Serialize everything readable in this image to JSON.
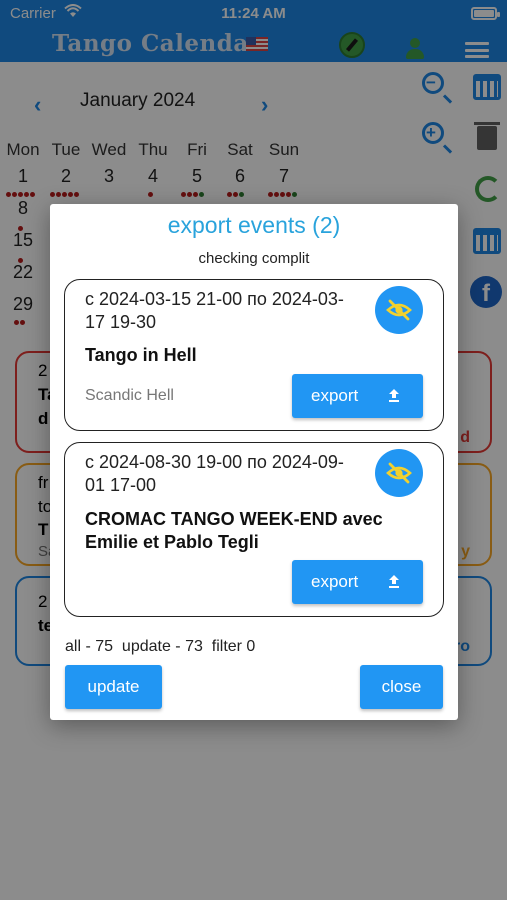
{
  "status_bar": {
    "carrier": "Carrier",
    "time": "11:24 AM"
  },
  "app": {
    "title": "Tango Calendar"
  },
  "calendar": {
    "month": "January 2024",
    "weekdays": [
      "Mon",
      "Tue",
      "Wed",
      "Thu",
      "Fri",
      "Sat",
      "Sun"
    ],
    "days_row1": [
      "1",
      "2",
      "3",
      "4",
      "5",
      "6",
      "7"
    ],
    "days_col1": [
      "8",
      "15",
      "22",
      "29"
    ]
  },
  "background_events": [
    {
      "line1": "2",
      "line2": "Ta",
      "line3": "d",
      "right": "d"
    },
    {
      "line1": "fr",
      "line2": "to",
      "line3": "T",
      "line4": "Sa",
      "right": "y"
    },
    {
      "line1": "2",
      "line2": "te",
      "right": "ro"
    }
  ],
  "dialog": {
    "title": "export events (2)",
    "subtitle": "checking complit",
    "events": [
      {
        "dates": "с 2024-03-15 21-00 по 2024-03-17 19-30",
        "name": "Tango in Hell",
        "venue": "Scandic Hell",
        "export_label": "export"
      },
      {
        "dates": "с 2024-08-30 19-00 по 2024-09-01 17-00",
        "name": "CROMAC TANGO WEEK-END avec Emilie et Pablo Tegli",
        "venue": "",
        "export_label": "export"
      }
    ],
    "stats": "all - 75  update - 73  filter 0",
    "update_label": "update",
    "close_label": "close"
  }
}
